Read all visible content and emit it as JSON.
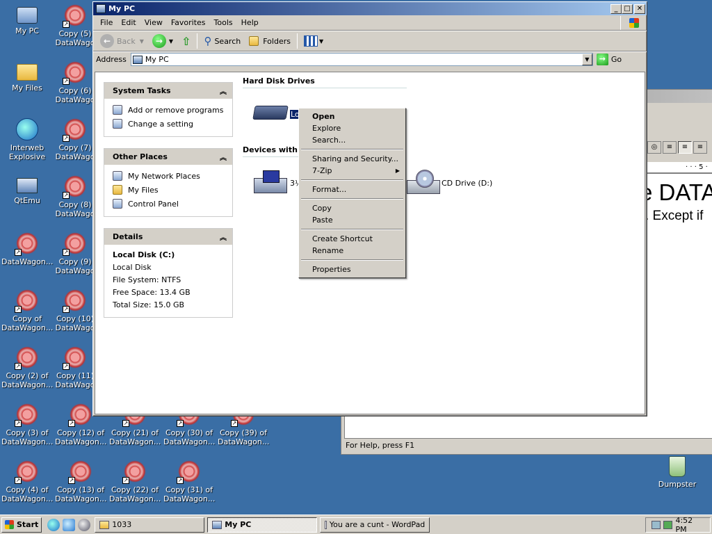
{
  "desktop": {
    "icons": [
      {
        "label": "My PC",
        "icon": "my-pc-icon"
      },
      {
        "label": "My Files",
        "icon": "my-files-icon"
      },
      {
        "label": "Interweb Explosive",
        "icon": "internet-explorer-icon"
      },
      {
        "label": "QtEmu",
        "icon": "qtemu-icon"
      },
      {
        "label": "DataWagon...",
        "icon": "datawagon-icon"
      },
      {
        "label": "Copy of DataWagon...",
        "icon": "datawagon-icon"
      },
      {
        "label": "Copy (2) of DataWagon...",
        "icon": "datawagon-icon"
      },
      {
        "label": "Copy (3) of DataWagon...",
        "icon": "datawagon-icon"
      },
      {
        "label": "Copy (4) of DataWagon...",
        "icon": "datawagon-icon"
      },
      {
        "label": "Copy (5) DataWago",
        "icon": "datawagon-icon"
      },
      {
        "label": "Copy (6) DataWago",
        "icon": "datawagon-icon"
      },
      {
        "label": "Copy (7) DataWago",
        "icon": "datawagon-icon"
      },
      {
        "label": "Copy (8) DataWago",
        "icon": "datawagon-icon"
      },
      {
        "label": "Copy (9) DataWago",
        "icon": "datawagon-icon"
      },
      {
        "label": "Copy (10) DataWago",
        "icon": "datawagon-icon"
      },
      {
        "label": "Copy (11) DataWago",
        "icon": "datawagon-icon"
      },
      {
        "label": "Copy (12) of DataWagon...",
        "icon": "datawagon-icon"
      },
      {
        "label": "Copy (13) of DataWagon...",
        "icon": "datawagon-icon"
      },
      {
        "label": "Copy (21) of DataWagon...",
        "icon": "datawagon-icon"
      },
      {
        "label": "Copy (22) of DataWagon...",
        "icon": "datawagon-icon"
      },
      {
        "label": "Copy (30) of DataWagon...",
        "icon": "datawagon-icon"
      },
      {
        "label": "Copy (31) of DataWagon...",
        "icon": "datawagon-icon"
      },
      {
        "label": "Copy (39) of DataWagon...",
        "icon": "datawagon-icon"
      },
      {
        "label": "Dumpster",
        "icon": "recycle-bin-icon"
      }
    ]
  },
  "explorer": {
    "title": "My PC",
    "menu": [
      "File",
      "Edit",
      "View",
      "Favorites",
      "Tools",
      "Help"
    ],
    "toolbar": {
      "back": "Back",
      "search": "Search",
      "folders": "Folders"
    },
    "address": {
      "label": "Address",
      "value": "My PC",
      "go": "Go"
    },
    "system_tasks": {
      "title": "System Tasks",
      "items": [
        "Add or remove programs",
        "Change a setting"
      ]
    },
    "other_places": {
      "title": "Other Places",
      "items": [
        "My Network Places",
        "My Files",
        "Control Panel"
      ]
    },
    "details": {
      "title": "Details",
      "name": "Local Disk (C:)",
      "type": "Local Disk",
      "file_system": "File System: NTFS",
      "free_space": "Free Space: 13.4 GB",
      "total_size": "Total Size: 15.0 GB"
    },
    "sections": {
      "hard_disks": "Hard Disk Drives",
      "removable": "Devices with"
    },
    "drives": {
      "local_disk": "Loc",
      "floppy": "3½",
      "cd": "CD Drive (D:)"
    }
  },
  "context_menu": {
    "items": [
      {
        "label": "Open",
        "bold": true
      },
      {
        "label": "Explore"
      },
      {
        "label": "Search..."
      },
      {
        "sep": true
      },
      {
        "label": "Sharing and Security..."
      },
      {
        "label": "7-Zip",
        "submenu": true
      },
      {
        "sep": true
      },
      {
        "label": "Format..."
      },
      {
        "sep": true
      },
      {
        "label": "Copy"
      },
      {
        "label": "Paste"
      },
      {
        "sep": true
      },
      {
        "label": "Create Shortcut"
      },
      {
        "label": "Rename"
      },
      {
        "sep": true
      },
      {
        "label": "Properties"
      }
    ]
  },
  "wordpad": {
    "big_text": "e DATA",
    "small_text": ". Except if",
    "ruler_mark": "· · · 5 ·",
    "status": "For Help, press F1"
  },
  "taskbar": {
    "start": "Start",
    "tasks": [
      {
        "label": "1033",
        "active": false
      },
      {
        "label": "My PC",
        "active": true
      },
      {
        "label": "You are a cunt - WordPad",
        "active": false
      }
    ],
    "clock": "4:52 PM"
  }
}
